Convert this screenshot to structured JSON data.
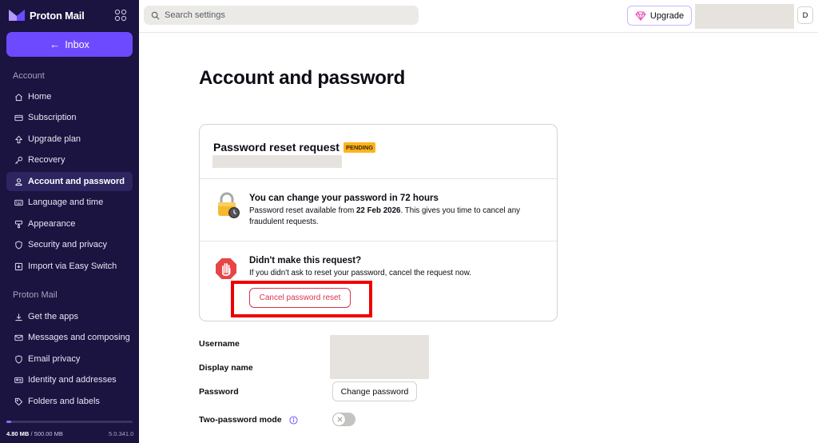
{
  "brand": {
    "name": "Proton Mail"
  },
  "sidebar": {
    "inbox_label": "Inbox",
    "sections": [
      {
        "title": "Account",
        "items": [
          {
            "label": "Home",
            "icon": "home-icon"
          },
          {
            "label": "Subscription",
            "icon": "card-icon"
          },
          {
            "label": "Upgrade plan",
            "icon": "upgrade-icon"
          },
          {
            "label": "Recovery",
            "icon": "key-icon"
          },
          {
            "label": "Account and password",
            "icon": "user-icon",
            "active": true
          },
          {
            "label": "Language and time",
            "icon": "keyboard-icon"
          },
          {
            "label": "Appearance",
            "icon": "paint-icon"
          },
          {
            "label": "Security and privacy",
            "icon": "shield-icon"
          },
          {
            "label": "Import via Easy Switch",
            "icon": "import-icon"
          }
        ]
      },
      {
        "title": "Proton Mail",
        "items": [
          {
            "label": "Get the apps",
            "icon": "download-icon"
          },
          {
            "label": "Messages and composing",
            "icon": "envelope-icon"
          },
          {
            "label": "Email privacy",
            "icon": "shield-icon"
          },
          {
            "label": "Identity and addresses",
            "icon": "id-card-icon"
          },
          {
            "label": "Folders and labels",
            "icon": "tag-icon"
          }
        ]
      }
    ],
    "storage": {
      "used": "4.80 MB",
      "total": "/ 500.00 MB",
      "fraction": 0.04
    },
    "version": "5.0.341.0"
  },
  "header": {
    "search_placeholder": "Search settings",
    "upgrade_label": "Upgrade",
    "avatar_initial": "D"
  },
  "main": {
    "title": "Account and password",
    "reset_card": {
      "title": "Password reset request",
      "badge": "PENDING",
      "wait": {
        "heading": "You can change your password in 72 hours",
        "text_before": "Password reset available from ",
        "date": "22 Feb 2026",
        "text_after": ". This gives you time to cancel any fraudulent requests."
      },
      "not_me": {
        "heading": "Didn't make this request?",
        "text": "If you didn't ask to reset your password, cancel the request now.",
        "cancel_label": "Cancel password reset"
      }
    },
    "fields": {
      "username_label": "Username",
      "display_name_label": "Display name",
      "password_label": "Password",
      "change_password_label": "Change password",
      "two_password_label": "Two-password mode",
      "two_password_enabled": false
    }
  },
  "colors": {
    "sidebar_bg": "#1b1340",
    "accent": "#6d4aff",
    "danger": "#dc3251",
    "badge": "#ffb21f",
    "highlight": "#ee0000"
  }
}
